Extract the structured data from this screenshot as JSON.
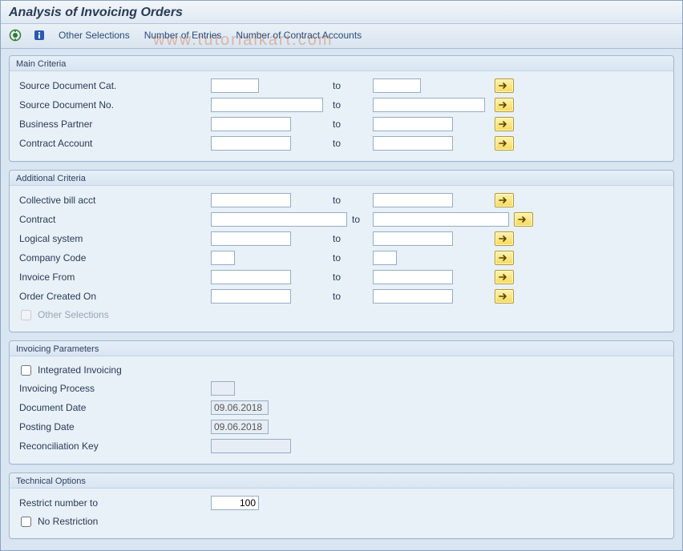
{
  "title": "Analysis of Invoicing Orders",
  "watermark": "www.tutorialkart.com",
  "toolbar": {
    "other_selections": "Other Selections",
    "num_entries": "Number of Entries",
    "num_contract_accounts": "Number of Contract Accounts"
  },
  "to_label": "to",
  "main": {
    "legend": "Main Criteria",
    "rows": {
      "src_doc_cat": {
        "label": "Source Document Cat.",
        "from": "",
        "to": ""
      },
      "src_doc_no": {
        "label": "Source Document No.",
        "from": "",
        "to": ""
      },
      "bp": {
        "label": "Business Partner",
        "from": "",
        "to": ""
      },
      "ca": {
        "label": "Contract Account",
        "from": "",
        "to": ""
      }
    }
  },
  "additional": {
    "legend": "Additional Criteria",
    "rows": {
      "coll_bill": {
        "label": "Collective bill acct",
        "from": "",
        "to": ""
      },
      "contract": {
        "label": "Contract",
        "from": "",
        "to": ""
      },
      "log_sys": {
        "label": "Logical system",
        "from": "",
        "to": ""
      },
      "comp_code": {
        "label": "Company Code",
        "from": "",
        "to": ""
      },
      "inv_from": {
        "label": "Invoice From",
        "from": "",
        "to": ""
      },
      "ord_created": {
        "label": "Order Created On",
        "from": "",
        "to": ""
      }
    },
    "other_selections_cb": "Other Selections"
  },
  "invoicing": {
    "legend": "Invoicing Parameters",
    "integrated": "Integrated Invoicing",
    "process": {
      "label": "Invoicing Process",
      "value": ""
    },
    "doc_date": {
      "label": "Document Date",
      "value": "09.06.2018"
    },
    "post_date": {
      "label": "Posting Date",
      "value": "09.06.2018"
    },
    "recon_key": {
      "label": "Reconciliation Key",
      "value": ""
    }
  },
  "technical": {
    "legend": "Technical Options",
    "restrict": {
      "label": "Restrict number to",
      "value": "100"
    },
    "no_restriction": "No Restriction"
  }
}
